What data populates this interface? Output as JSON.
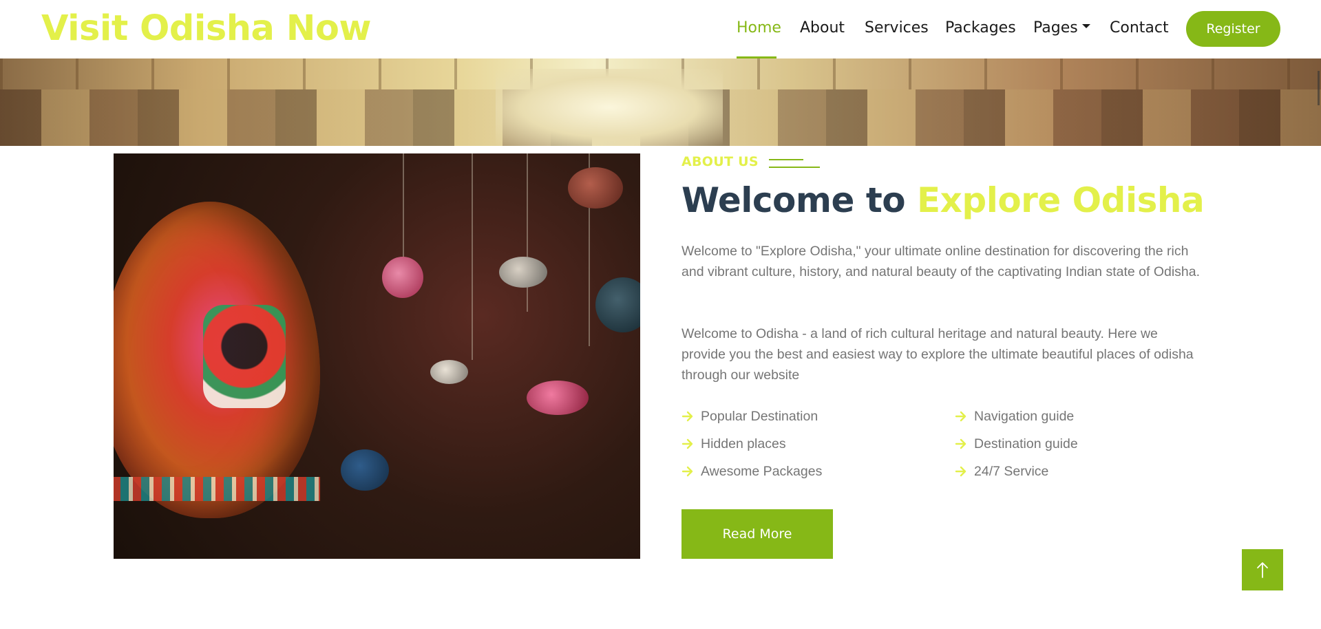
{
  "navbar": {
    "brand": "Visit Odisha Now",
    "items": [
      {
        "label": "Home",
        "active": true
      },
      {
        "label": "About"
      },
      {
        "label": "Services"
      },
      {
        "label": "Packages"
      },
      {
        "label": "Pages"
      },
      {
        "label": "Contact"
      }
    ],
    "register_label": "Register"
  },
  "about": {
    "section_label": "ABOUT US",
    "title_part1": "Welcome to ",
    "title_part2": "Explore Odisha",
    "paragraph1": "Welcome to \"Explore Odisha,\" your ultimate online destination for discovering the rich and vibrant culture, history, and natural beauty of the captivating Indian state of Odisha.",
    "paragraph2": "Welcome to Odisha - a land of rich cultural heritage and natural beauty. Here we provide you the best and easiest way to explore the ultimate beautiful places of odisha through our website",
    "features_left": [
      "Popular Destination",
      "Hidden places",
      "Awesome Packages"
    ],
    "features_right": [
      "Navigation guide",
      "Destination guide",
      "24/7 Service"
    ],
    "read_more_label": "Read More"
  },
  "icons": {
    "feature_bullet": "arrow-right-icon",
    "back_to_top": "arrow-up-icon",
    "dropdown": "caret-down-icon"
  },
  "colors": {
    "primary": "#86b817",
    "brand_yellow": "#e3f04a",
    "heading": "#2c3e50",
    "body_text": "#757575"
  }
}
